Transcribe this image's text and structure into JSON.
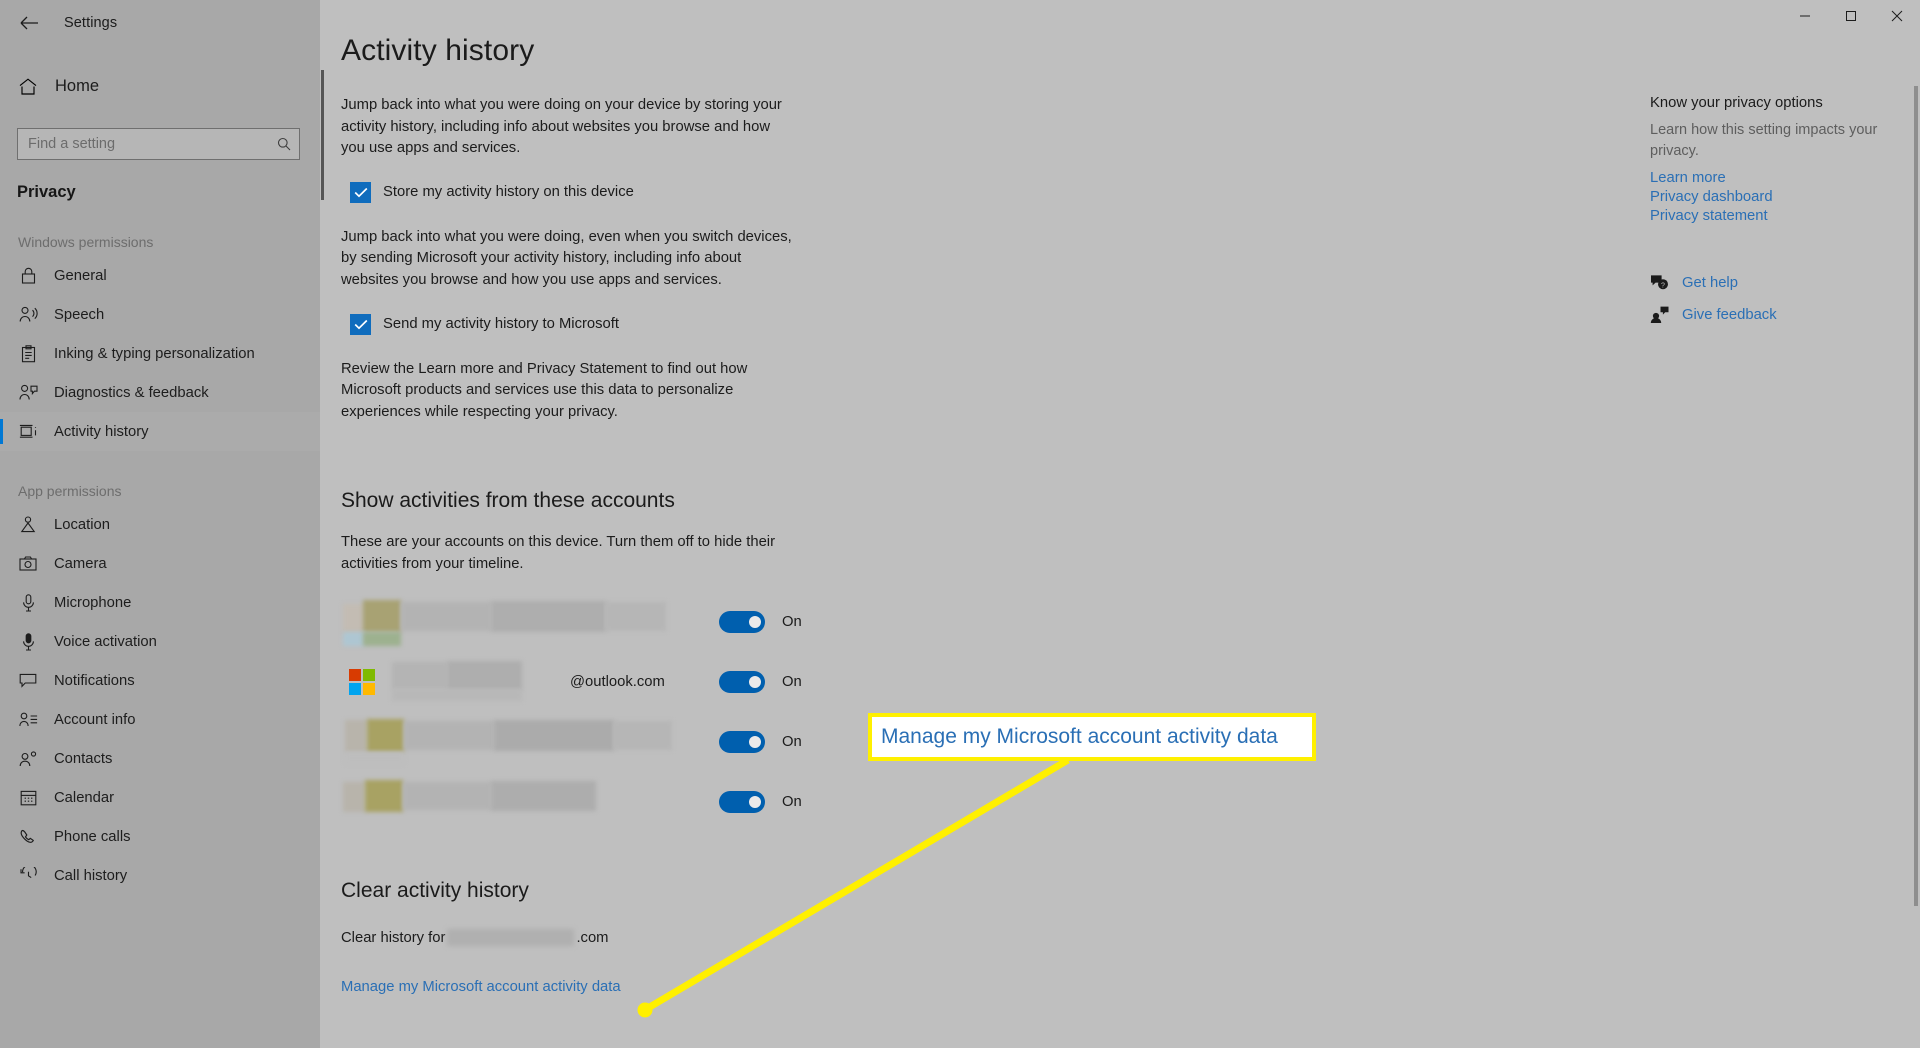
{
  "window": {
    "title": "Settings",
    "back_icon": "back-arrow-icon",
    "minimize_label": "Minimize",
    "maximize_label": "Maximize",
    "close_label": "Close"
  },
  "sidebar": {
    "home_label": "Home",
    "home_icon": "home-icon",
    "search": {
      "placeholder": "Find a setting",
      "value": "",
      "icon": "search-icon"
    },
    "category": "Privacy",
    "groups": [
      {
        "title": "Windows permissions",
        "items": [
          {
            "label": "General",
            "icon": "lock-icon",
            "selected": false
          },
          {
            "label": "Speech",
            "icon": "speech-person-icon",
            "selected": false
          },
          {
            "label": "Inking & typing personalization",
            "icon": "clipboard-pen-icon",
            "selected": false
          },
          {
            "label": "Diagnostics & feedback",
            "icon": "person-feedback-icon",
            "selected": false
          },
          {
            "label": "Activity history",
            "icon": "activity-history-icon",
            "selected": true
          }
        ]
      },
      {
        "title": "App permissions",
        "items": [
          {
            "label": "Location",
            "icon": "location-person-icon",
            "selected": false
          },
          {
            "label": "Camera",
            "icon": "camera-icon",
            "selected": false
          },
          {
            "label": "Microphone",
            "icon": "microphone-icon",
            "selected": false
          },
          {
            "label": "Voice activation",
            "icon": "voice-activation-icon",
            "selected": false
          },
          {
            "label": "Notifications",
            "icon": "notification-balloon-icon",
            "selected": false
          },
          {
            "label": "Account info",
            "icon": "account-info-icon",
            "selected": false
          },
          {
            "label": "Contacts",
            "icon": "contacts-icon",
            "selected": false
          },
          {
            "label": "Calendar",
            "icon": "calendar-icon",
            "selected": false
          },
          {
            "label": "Phone calls",
            "icon": "phone-icon",
            "selected": false
          },
          {
            "label": "Call history",
            "icon": "call-history-icon",
            "selected": false
          }
        ]
      }
    ]
  },
  "main": {
    "page_title": "Activity history",
    "intro_paragraph": "Jump back into what you were doing on your device by storing your activity history, including info about websites you browse and how you use apps and services.",
    "store_checkbox": {
      "label": "Store my activity history on this device",
      "checked": true
    },
    "second_paragraph": "Jump back into what you were doing, even when you switch devices, by sending Microsoft your activity history, including info about websites you browse and how you use apps and services.",
    "send_checkbox": {
      "label": "Send my activity history to Microsoft",
      "checked": true
    },
    "third_paragraph": "Review the Learn more and Privacy Statement to find out how Microsoft products and services use this data to personalize experiences while respecting your privacy.",
    "accounts_section": {
      "heading": "Show activities from these accounts",
      "description": "These are your accounts on this device. Turn them off to hide their activities from your timeline.",
      "rows": [
        {
          "name_redacted": true,
          "email": "",
          "avatar": "redacted-avatar",
          "toggle": "On"
        },
        {
          "name_redacted": true,
          "email": "@outlook.com",
          "avatar": "microsoft-logo",
          "toggle": "On"
        },
        {
          "name_redacted": true,
          "email": "",
          "avatar": "redacted-avatar",
          "toggle": "On"
        },
        {
          "name_redacted": true,
          "email": "",
          "avatar": "redacted-avatar",
          "toggle": "On"
        }
      ]
    },
    "clear_section": {
      "heading": "Clear activity history",
      "clear_for_prefix": "Clear history for",
      "clear_for_suffix": ".com",
      "manage_link": "Manage my Microsoft account activity data"
    }
  },
  "right_rail": {
    "title": "Know your privacy options",
    "subtitle": "Learn how this setting impacts your privacy.",
    "links": [
      "Learn more",
      "Privacy dashboard",
      "Privacy statement"
    ],
    "help": [
      {
        "label": "Get help",
        "icon": "help-chat-icon"
      },
      {
        "label": "Give feedback",
        "icon": "feedback-person-icon"
      }
    ]
  },
  "annotation": {
    "callout_text": "Manage my Microsoft account activity data",
    "highlight_color": "#fff000",
    "link_color": "#2a6fb5"
  }
}
